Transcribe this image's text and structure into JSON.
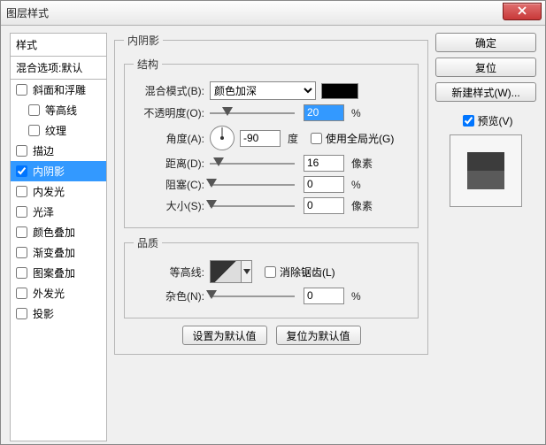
{
  "title": "图层样式",
  "sidebar": {
    "header": "样式",
    "sub": "混合选项:默认",
    "items": [
      {
        "label": "斜面和浮雕",
        "checked": false,
        "indent": false
      },
      {
        "label": "等高线",
        "checked": false,
        "indent": true
      },
      {
        "label": "纹理",
        "checked": false,
        "indent": true
      },
      {
        "label": "描边",
        "checked": false,
        "indent": false
      },
      {
        "label": "内阴影",
        "checked": true,
        "indent": false,
        "selected": true
      },
      {
        "label": "内发光",
        "checked": false,
        "indent": false
      },
      {
        "label": "光泽",
        "checked": false,
        "indent": false
      },
      {
        "label": "颜色叠加",
        "checked": false,
        "indent": false
      },
      {
        "label": "渐变叠加",
        "checked": false,
        "indent": false
      },
      {
        "label": "图案叠加",
        "checked": false,
        "indent": false
      },
      {
        "label": "外发光",
        "checked": false,
        "indent": false
      },
      {
        "label": "投影",
        "checked": false,
        "indent": false
      }
    ]
  },
  "main": {
    "group_title": "内阴影",
    "struct_title": "结构",
    "quality_title": "品质",
    "blend_label": "混合模式(B):",
    "blend_value": "颜色加深",
    "swatch_color": "#000000",
    "opacity_label": "不透明度(O):",
    "opacity_value": "20",
    "opacity_unit": "%",
    "angle_label": "角度(A):",
    "angle_value": "-90",
    "angle_unit": "度",
    "global_light_label": "使用全局光(G)",
    "global_light_checked": false,
    "distance_label": "距离(D):",
    "distance_value": "16",
    "distance_unit": "像素",
    "choke_label": "阻塞(C):",
    "choke_value": "0",
    "choke_unit": "%",
    "size_label": "大小(S):",
    "size_value": "0",
    "size_unit": "像素",
    "contour_label": "等高线:",
    "antialias_label": "消除锯齿(L)",
    "antialias_checked": false,
    "noise_label": "杂色(N):",
    "noise_value": "0",
    "noise_unit": "%",
    "set_default_btn": "设置为默认值",
    "reset_default_btn": "复位为默认值"
  },
  "right": {
    "ok": "确定",
    "reset": "复位",
    "new_style": "新建样式(W)...",
    "preview_label": "预览(V)",
    "preview_checked": true
  }
}
